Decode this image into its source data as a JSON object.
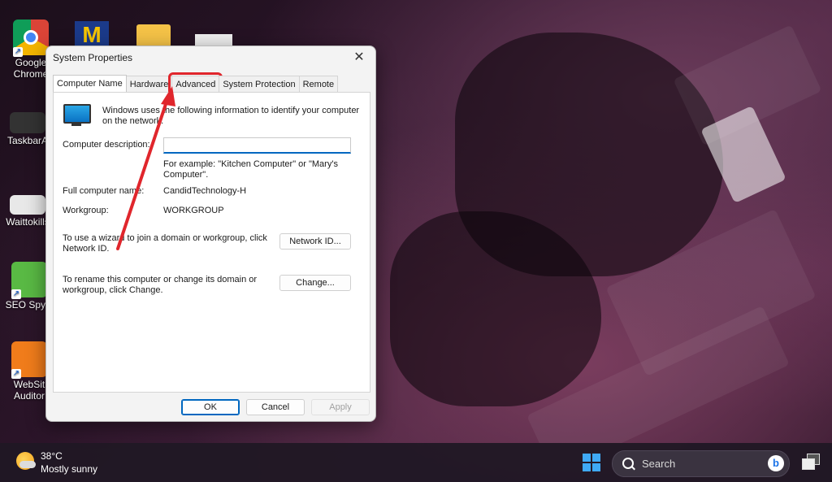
{
  "desktop": {
    "icons": [
      {
        "label_line1": "Google",
        "label_line2": "Chrome"
      },
      {
        "label_line1": "TaskbarA",
        "label_line2": ""
      },
      {
        "label_line1": "Waittokills",
        "label_line2": ""
      },
      {
        "label_line1": "SEO SpyG",
        "label_line2": ""
      },
      {
        "label_line1": "WebSit",
        "label_line2": "Auditor"
      }
    ]
  },
  "dialog": {
    "title": "System Properties",
    "close_glyph": "✕",
    "tabs": [
      "Computer Name",
      "Hardware",
      "Advanced",
      "System Protection",
      "Remote"
    ],
    "active_tab": "Computer Name",
    "highlighted_tab": "Advanced",
    "info_line1": "Windows uses the following information to identify your computer",
    "info_line2": "on the network.",
    "description_label": "Computer description:",
    "description_value": "",
    "example_line1": "For example: \"Kitchen Computer\" or \"Mary's",
    "example_line2": "Computer\".",
    "full_name_label": "Full computer name:",
    "full_name_value": "CandidTechnology-H",
    "workgroup_label": "Workgroup:",
    "workgroup_value": "WORKGROUP",
    "network_text_line1": "To use a wizard to join a domain or workgroup, click",
    "network_text_line2": "Network ID.",
    "network_button": "Network ID...",
    "rename_text_line1": "To rename this computer or change its domain or",
    "rename_text_line2": "workgroup, click Change.",
    "change_button": "Change...",
    "ok_button": "OK",
    "cancel_button": "Cancel",
    "apply_button": "Apply"
  },
  "annotation": {
    "color": "#e0262c",
    "icon": "red-arrow"
  },
  "taskbar": {
    "weather_temp": "38°C",
    "weather_desc": "Mostly sunny",
    "search_label": "Search",
    "bing_glyph": "b"
  }
}
